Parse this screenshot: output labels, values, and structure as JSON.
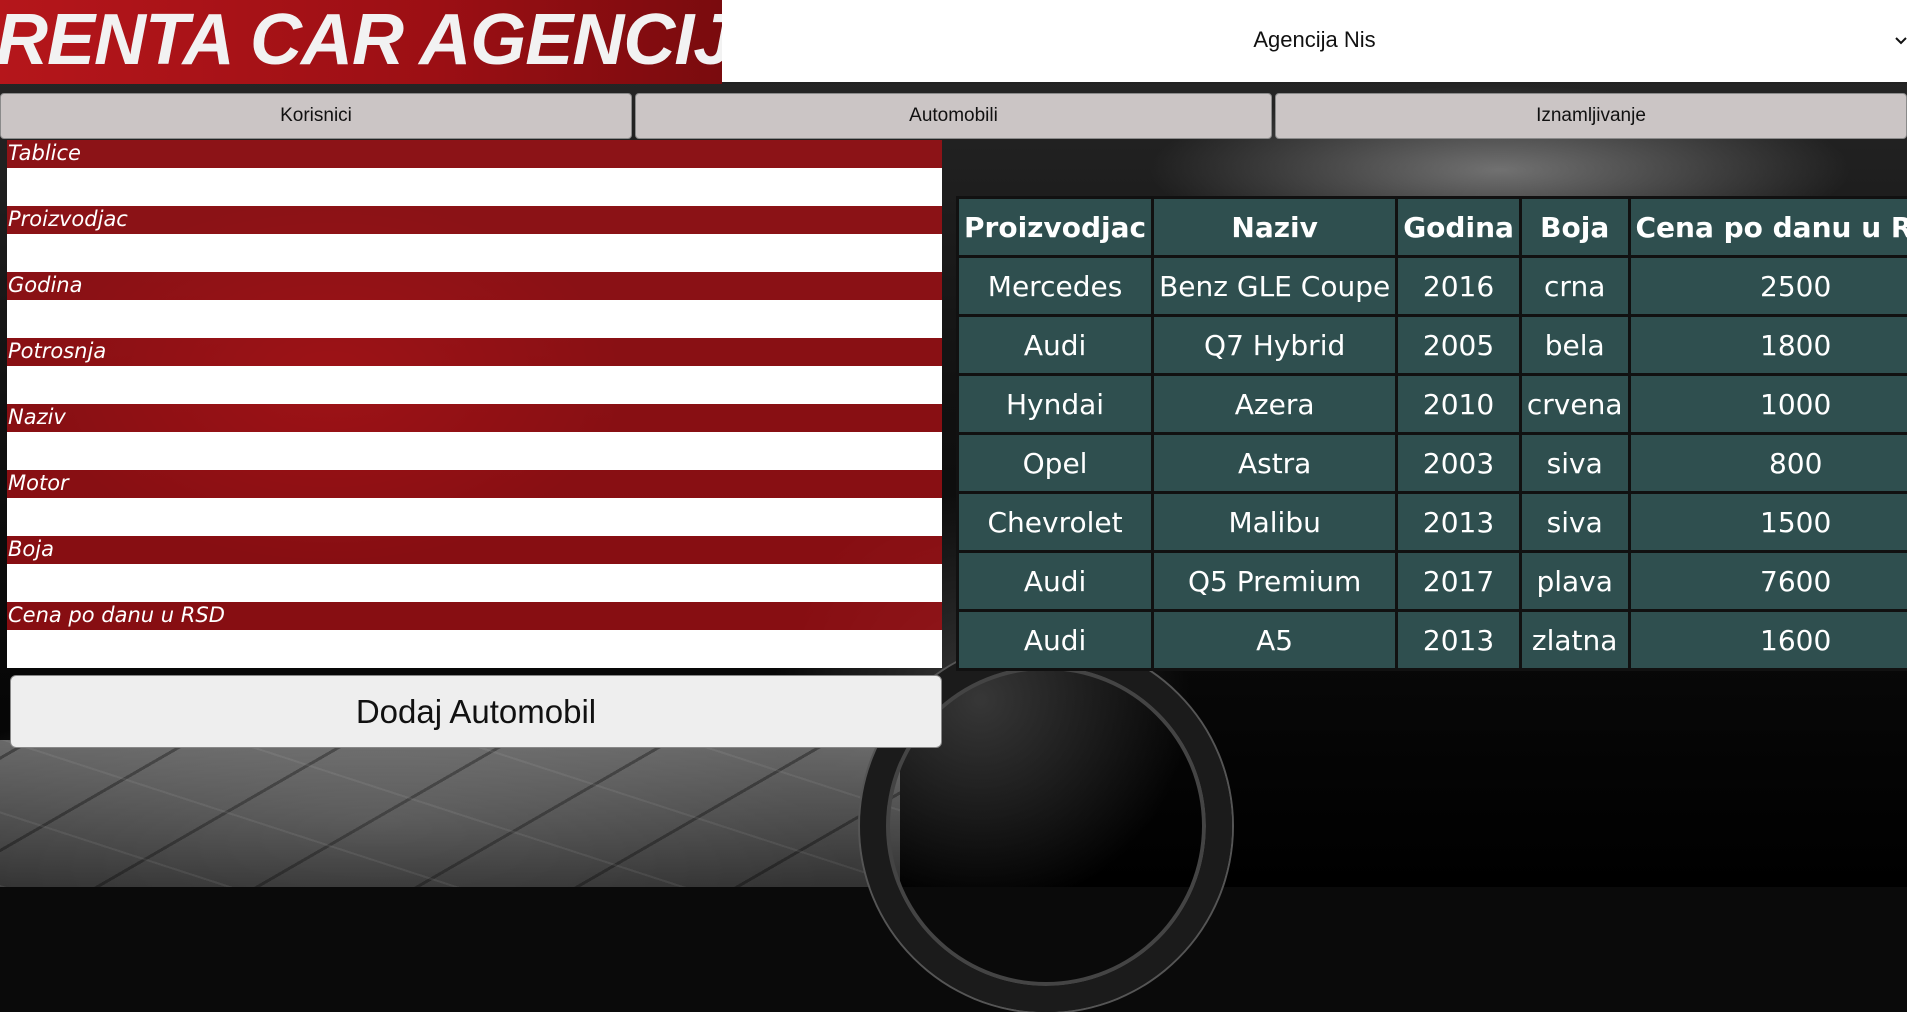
{
  "header": {
    "logo_text": "RENTA CAR AGENCIJA",
    "agency_select": {
      "value": "Agencija Nis",
      "icon": "chevron-down-icon"
    }
  },
  "nav": {
    "tabs": [
      {
        "label": "Korisnici"
      },
      {
        "label": "Automobili"
      },
      {
        "label": "Iznamljivanje"
      }
    ]
  },
  "form": {
    "fields": [
      {
        "label": "Tablice",
        "value": ""
      },
      {
        "label": "Proizvodjac",
        "value": ""
      },
      {
        "label": "Godina",
        "value": ""
      },
      {
        "label": "Potrosnja",
        "value": ""
      },
      {
        "label": "Naziv",
        "value": ""
      },
      {
        "label": "Motor",
        "value": ""
      },
      {
        "label": "Boja",
        "value": ""
      },
      {
        "label": "Cena po danu u RSD",
        "value": ""
      }
    ],
    "submit_label": "Dodaj Automobil"
  },
  "table": {
    "columns": [
      "Proizvodjac",
      "Naziv",
      "Godina",
      "Boja",
      "Cena po danu u RSD"
    ],
    "rows": [
      [
        "Mercedes",
        "Benz GLE Coupe",
        "2016",
        "crna",
        "2500"
      ],
      [
        "Audi",
        "Q7 Hybrid",
        "2005",
        "bela",
        "1800"
      ],
      [
        "Hyndai",
        "Azera",
        "2010",
        "crvena",
        "1000"
      ],
      [
        "Opel",
        "Astra",
        "2003",
        "siva",
        "800"
      ],
      [
        "Chevrolet",
        "Malibu",
        "2013",
        "siva",
        "1500"
      ],
      [
        "Audi",
        "Q5 Premium",
        "2017",
        "plava",
        "7600"
      ],
      [
        "Audi",
        "A5",
        "2013",
        "zlatna",
        "1600"
      ]
    ]
  },
  "colors": {
    "logo_red": "#b5161b",
    "label_red": "#aa0f14",
    "table_bg": "#2f4f4f",
    "nav_bg": "#cbc5c5"
  }
}
